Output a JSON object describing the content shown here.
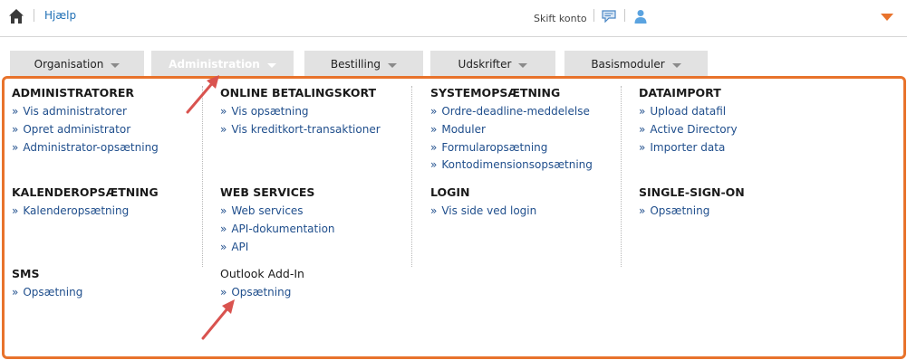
{
  "topbar": {
    "help": "Hjælp",
    "switch_account": "Skift konto"
  },
  "tabs": [
    {
      "label": "Organisation"
    },
    {
      "label": "Administration"
    },
    {
      "label": "Bestilling"
    },
    {
      "label": "Udskrifter"
    },
    {
      "label": "Basismoduler"
    }
  ],
  "sections": {
    "administratorer": {
      "title": "ADMINISTRATORER",
      "items": [
        "Vis administratorer",
        "Opret administrator",
        "Administrator-opsætning"
      ]
    },
    "online_betalingskort": {
      "title": "ONLINE BETALINGSKORT",
      "items": [
        "Vis opsætning",
        "Vis kreditkort-transaktioner"
      ]
    },
    "systemopsaetning": {
      "title": "SYSTEMOPSÆTNING",
      "items": [
        "Ordre-deadline-meddelelse",
        "Moduler",
        "Formularopsætning",
        "Kontodimensionsopsætning"
      ]
    },
    "dataimport": {
      "title": "DATAIMPORT",
      "items": [
        "Upload datafil",
        "Active Directory",
        "Importer data"
      ]
    },
    "kalenderopsaetning": {
      "title": "KALENDEROPSÆTNING",
      "items": [
        "Kalenderopsætning"
      ]
    },
    "web_services": {
      "title": "WEB SERVICES",
      "items": [
        "Web services",
        "API-dokumentation",
        "API"
      ]
    },
    "login": {
      "title": "LOGIN",
      "items": [
        "Vis side ved login"
      ]
    },
    "single_sign_on": {
      "title": "SINGLE-SIGN-ON",
      "items": [
        "Opsætning"
      ]
    },
    "sms": {
      "title": "SMS",
      "items": [
        "Opsætning"
      ]
    },
    "outlook_add_in": {
      "title": "Outlook Add-In",
      "items": [
        "Opsætning"
      ]
    }
  },
  "colors": {
    "accent": "#e8732c",
    "link": "#1f4e8c",
    "tab_bg": "#e2e2e2",
    "annotation_arrow": "#d9534f"
  },
  "icons": [
    "home-icon",
    "chat-icon",
    "user-icon",
    "caret-down-icon",
    "chevron-down-icon",
    "annotation-arrow"
  ]
}
